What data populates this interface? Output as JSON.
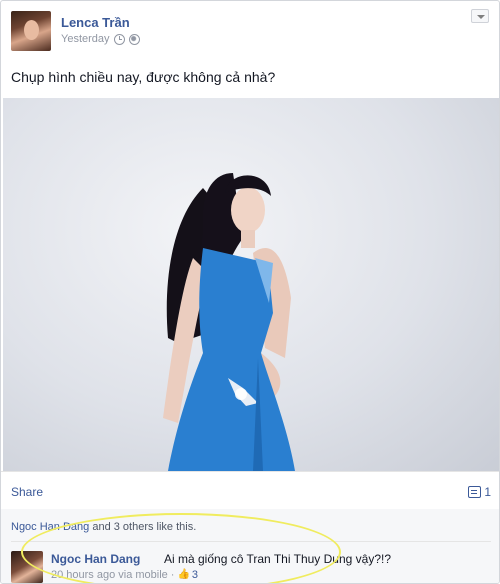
{
  "post": {
    "author": "Lenca Trần",
    "timestamp": "Yesterday",
    "icons": [
      "clock-icon",
      "globe-icon",
      "chevron-down-icon"
    ],
    "status": "Chụp hình chiều nay, được không cả nhà?"
  },
  "actions": {
    "share_label": "Share",
    "comment_count": "1"
  },
  "ufi": {
    "likes_name": "Ngoc Han Dang",
    "likes_rest": " and 3 others like this.",
    "comment": {
      "author": "Ngoc Han Dang",
      "text": "Ai mà giống cô Tran Thi Thuy Dung vậy?!?",
      "time": "20 hours ago via mobile",
      "separator": "·",
      "like_count": "3"
    }
  },
  "colors": {
    "link": "#3b5998",
    "highlight_ellipse": "#f0ec5f",
    "dress": "#2a7fd0"
  }
}
